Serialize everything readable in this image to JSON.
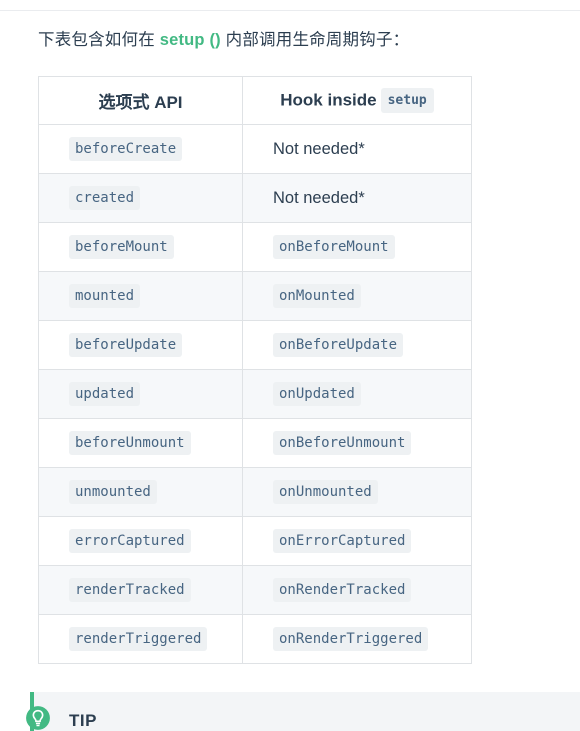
{
  "intro": {
    "prefix": "下表包含如何在 ",
    "keyword": "setup ()",
    "suffix": " 内部调用生命周期钩子："
  },
  "table": {
    "headers": {
      "col1": "选项式 API",
      "col2_text": "Hook inside",
      "col2_code": "setup"
    },
    "rows": [
      {
        "option_api": "beforeCreate",
        "option_is_code": true,
        "hook": "Not needed*",
        "hook_is_code": false
      },
      {
        "option_api": "created",
        "option_is_code": true,
        "hook": "Not needed*",
        "hook_is_code": false
      },
      {
        "option_api": "beforeMount",
        "option_is_code": true,
        "hook": "onBeforeMount",
        "hook_is_code": true
      },
      {
        "option_api": "mounted",
        "option_is_code": true,
        "hook": "onMounted",
        "hook_is_code": true
      },
      {
        "option_api": "beforeUpdate",
        "option_is_code": true,
        "hook": "onBeforeUpdate",
        "hook_is_code": true
      },
      {
        "option_api": "updated",
        "option_is_code": true,
        "hook": "onUpdated",
        "hook_is_code": true
      },
      {
        "option_api": "beforeUnmount",
        "option_is_code": true,
        "hook": "onBeforeUnmount",
        "hook_is_code": true
      },
      {
        "option_api": "unmounted",
        "option_is_code": true,
        "hook": "onUnmounted",
        "hook_is_code": true
      },
      {
        "option_api": "errorCaptured",
        "option_is_code": true,
        "hook": "onErrorCaptured",
        "hook_is_code": true
      },
      {
        "option_api": "renderTracked",
        "option_is_code": true,
        "hook": "onRenderTracked",
        "hook_is_code": true
      },
      {
        "option_api": "renderTriggered",
        "option_is_code": true,
        "hook": "onRenderTriggered",
        "hook_is_code": true
      }
    ]
  },
  "tip": {
    "title": "TIP",
    "icon": "lightbulb-icon"
  },
  "colors": {
    "accent_green": "#42b983",
    "text": "#2c3e50",
    "code_text": "#476582",
    "code_bg": "#eef1f3",
    "border": "#dfe2e5",
    "stripe": "#f6f8fa",
    "tip_bg": "#f3f5f7"
  }
}
